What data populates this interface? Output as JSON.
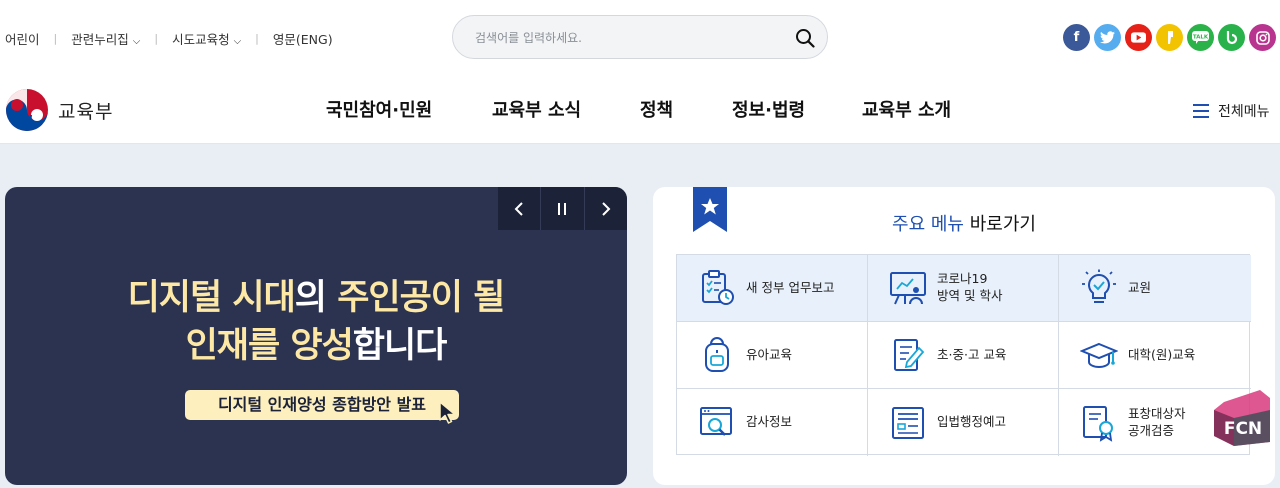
{
  "topbar": {
    "links": [
      {
        "label": "어린이",
        "dropdown": false
      },
      {
        "label": "관련누리집",
        "dropdown": true
      },
      {
        "label": "시도교육청",
        "dropdown": true
      },
      {
        "label": "영문(ENG)",
        "dropdown": false
      }
    ],
    "search": {
      "placeholder": "검색어를 입력하세요."
    },
    "socials": [
      {
        "icon": "facebook-icon",
        "glyph": "f",
        "color": "#3b5998"
      },
      {
        "icon": "twitter-icon",
        "glyph": "t",
        "color": "#55acee"
      },
      {
        "icon": "youtube-icon",
        "glyph": "▶",
        "color": "#e62117"
      },
      {
        "icon": "kakaostory-icon",
        "glyph": "ᑊ",
        "color": "#f2c300"
      },
      {
        "icon": "kakaotalk-icon",
        "glyph": "TALK",
        "color": "#2bb34a"
      },
      {
        "icon": "blog-icon",
        "glyph": "b",
        "color": "#29b24b"
      },
      {
        "icon": "instagram-icon",
        "glyph": "◎",
        "color": "#b9348f"
      }
    ]
  },
  "nav": {
    "logo": "교육부",
    "items": [
      "국민참여·민원",
      "교육부 소식",
      "정책",
      "정보·법령",
      "교육부 소개"
    ],
    "all_menu": "전체메뉴"
  },
  "banner": {
    "line1_a": "디지털 시대",
    "line1_b": "의 ",
    "line1_c": "주인공이 될",
    "line2_a": "인재를 양성",
    "line2_b": "합니다",
    "button": "디지털 인재양성 종합방안 발표",
    "controls": {
      "prev": "‹",
      "pause": "Ⅱ",
      "next": "›"
    }
  },
  "quick": {
    "title_a": "주요 메뉴",
    "title_b": " 바로가기",
    "items": [
      {
        "l1": "새 정부 업무보고",
        "l2": "",
        "icon": "clipboard-clock-icon"
      },
      {
        "l1": "코로나19",
        "l2": "방역 및 학사",
        "icon": "presentation-icon"
      },
      {
        "l1": "교원",
        "l2": "",
        "icon": "lightbulb-icon"
      },
      {
        "l1": "유아교육",
        "l2": "",
        "icon": "backpack-icon"
      },
      {
        "l1": "초·중·고 교육",
        "l2": "",
        "icon": "notebook-pencil-icon"
      },
      {
        "l1": "대학(원)교육",
        "l2": "",
        "icon": "graduation-cap-icon"
      },
      {
        "l1": "감사정보",
        "l2": "",
        "icon": "magnifier-window-icon"
      },
      {
        "l1": "입법행정예고",
        "l2": "",
        "icon": "document-list-icon"
      },
      {
        "l1": "표창대상자",
        "l2": "공개검증",
        "icon": "certificate-badge-icon"
      }
    ]
  },
  "watermark": "FCN"
}
